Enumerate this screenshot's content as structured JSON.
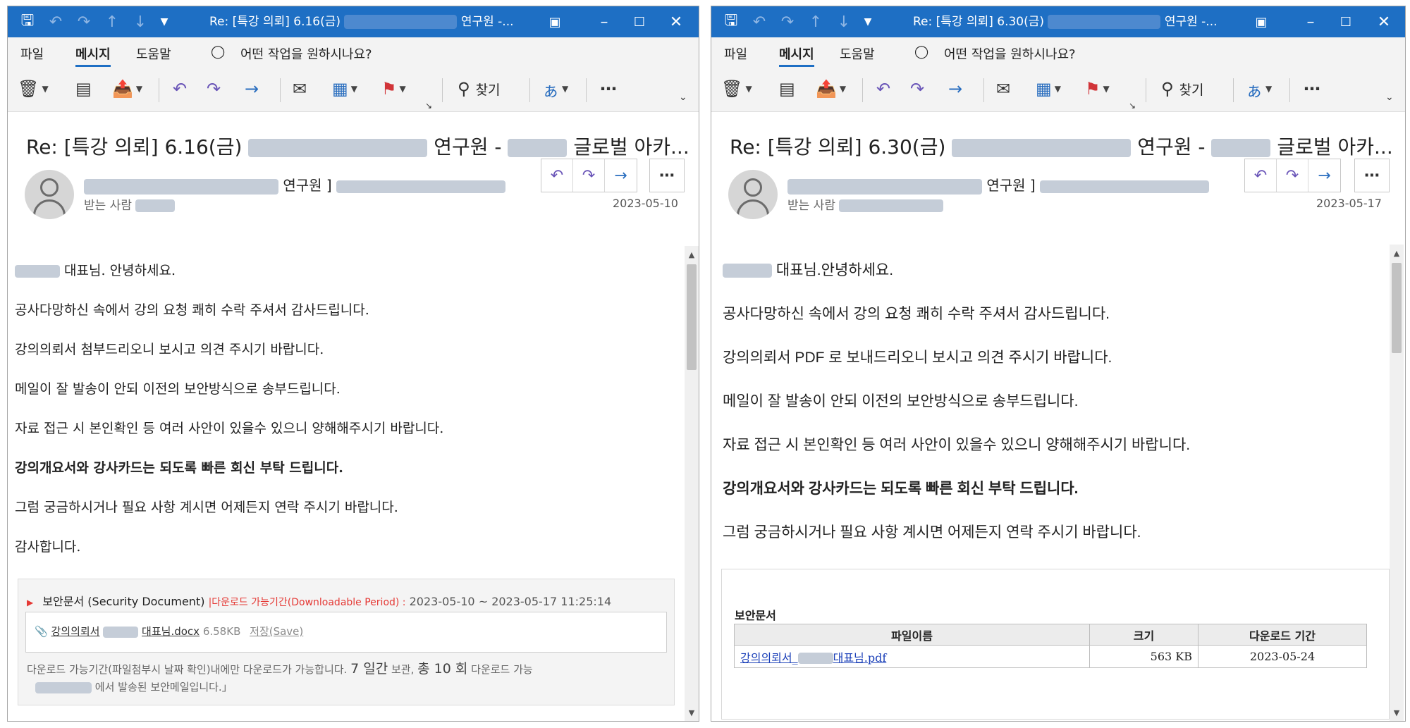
{
  "windows": [
    {
      "id": "win1",
      "title_prefix": "Re: [특강 의뢰] 6.16(금)",
      "title_suffix": "연구원 -...",
      "menu": {
        "file": "파일",
        "message": "메시지",
        "help": "도움말"
      },
      "tell_me": "어떤 작업을 원하시나요?",
      "find_label": "찾기",
      "subject_prefix": "Re: [특강 의뢰] 6.16(금)",
      "subject_mid": "연구원 -",
      "subject_suffix": "글로벌 아카...",
      "from_suffix": "연구원 ]",
      "to_label": "받는 사람",
      "date": "2023-05-10",
      "body": {
        "greeting": "대표님. 안녕하세요.",
        "p1": "공사다망하신 속에서 강의 요청 쾌히 수락 주셔서 감사드립니다.",
        "p2": "강의의뢰서 첨부드리오니 보시고 의견 주시기 바랍니다.",
        "p3": "메일이 잘 발송이 안되 이전의 보안방식으로 송부드립니다.",
        "p4": "자료 접근 시 본인확인 등 여러 사안이 있을수 있으니 양해해주시기 바랍니다.",
        "p5": "강의개요서와 강사카드는 되도록 빠른 회신 부탁 드립니다.",
        "p6": "그럼 궁금하시거나 필요 사항 계시면 어제든지 연락 주시기 바랍니다.",
        "p7": "감사합니다."
      },
      "security": {
        "title": "보안문서 (Security Document)",
        "period_label": "|다운로드 가능기간(Downloadable Period) :",
        "period_value": "2023-05-10 ~ 2023-05-17 11:25:14",
        "file_prefix": "강의의뢰서",
        "file_suffix": "대표님.docx",
        "file_size": "6.58KB",
        "save_label": "저장(Save)",
        "note_a": "다운로드 가능기간(파일첨부시 날짜 확인)내에만 다운로드가 가능합니다.",
        "note_days": "7 일간",
        "note_b": "보관,",
        "note_count": "총 10 회",
        "note_c": "다운로드 가능",
        "note2": "에서 발송된 보안메일입니다.」"
      }
    },
    {
      "id": "win2",
      "title_prefix": "Re: [특강 의뢰] 6.30(금)",
      "title_suffix": "연구원 -...",
      "menu": {
        "file": "파일",
        "message": "메시지",
        "help": "도움말"
      },
      "tell_me": "어떤 작업을 원하시나요?",
      "find_label": "찾기",
      "subject_prefix": "Re: [특강 의뢰] 6.30(금)",
      "subject_mid": "연구원 -",
      "subject_suffix": "글로벌 아카...",
      "from_suffix": "연구원 ]",
      "to_label": "받는 사람",
      "date": "2023-05-17",
      "body": {
        "greeting": "대표님.안녕하세요.",
        "p1": "공사다망하신 속에서 강의 요청 쾌히 수락 주셔서 감사드립니다.",
        "p2": "강의의뢰서 PDF 로 보내드리오니 보시고 의견 주시기 바랍니다.",
        "p3": "메일이 잘 발송이 안되 이전의 보안방식으로 송부드립니다.",
        "p4": "자료 접근 시 본인확인 등 여러 사안이 있을수 있으니 양해해주시기 바랍니다.",
        "p5": "강의개요서와 강사카드는 되도록 빠른 회신 부탁 드립니다.",
        "p6": "그럼 궁금하시거나 필요 사항 계시면 어제든지 연락 주시기 바랍니다."
      },
      "attachment": {
        "title": "보안문서",
        "headers": [
          "파일이름",
          "크기",
          "다운로드 기간"
        ],
        "file_prefix": "강의의뢰서_",
        "file_suffix": "대표님.pdf",
        "size": "563 KB",
        "period": "2023-05-24"
      }
    }
  ],
  "colors": {
    "titlebar": "#1e6fc4",
    "accent_purple": "#6a55b8",
    "accent_blue": "#2a6ebf",
    "flag_red": "#d13438",
    "period_red": "#e53935"
  }
}
